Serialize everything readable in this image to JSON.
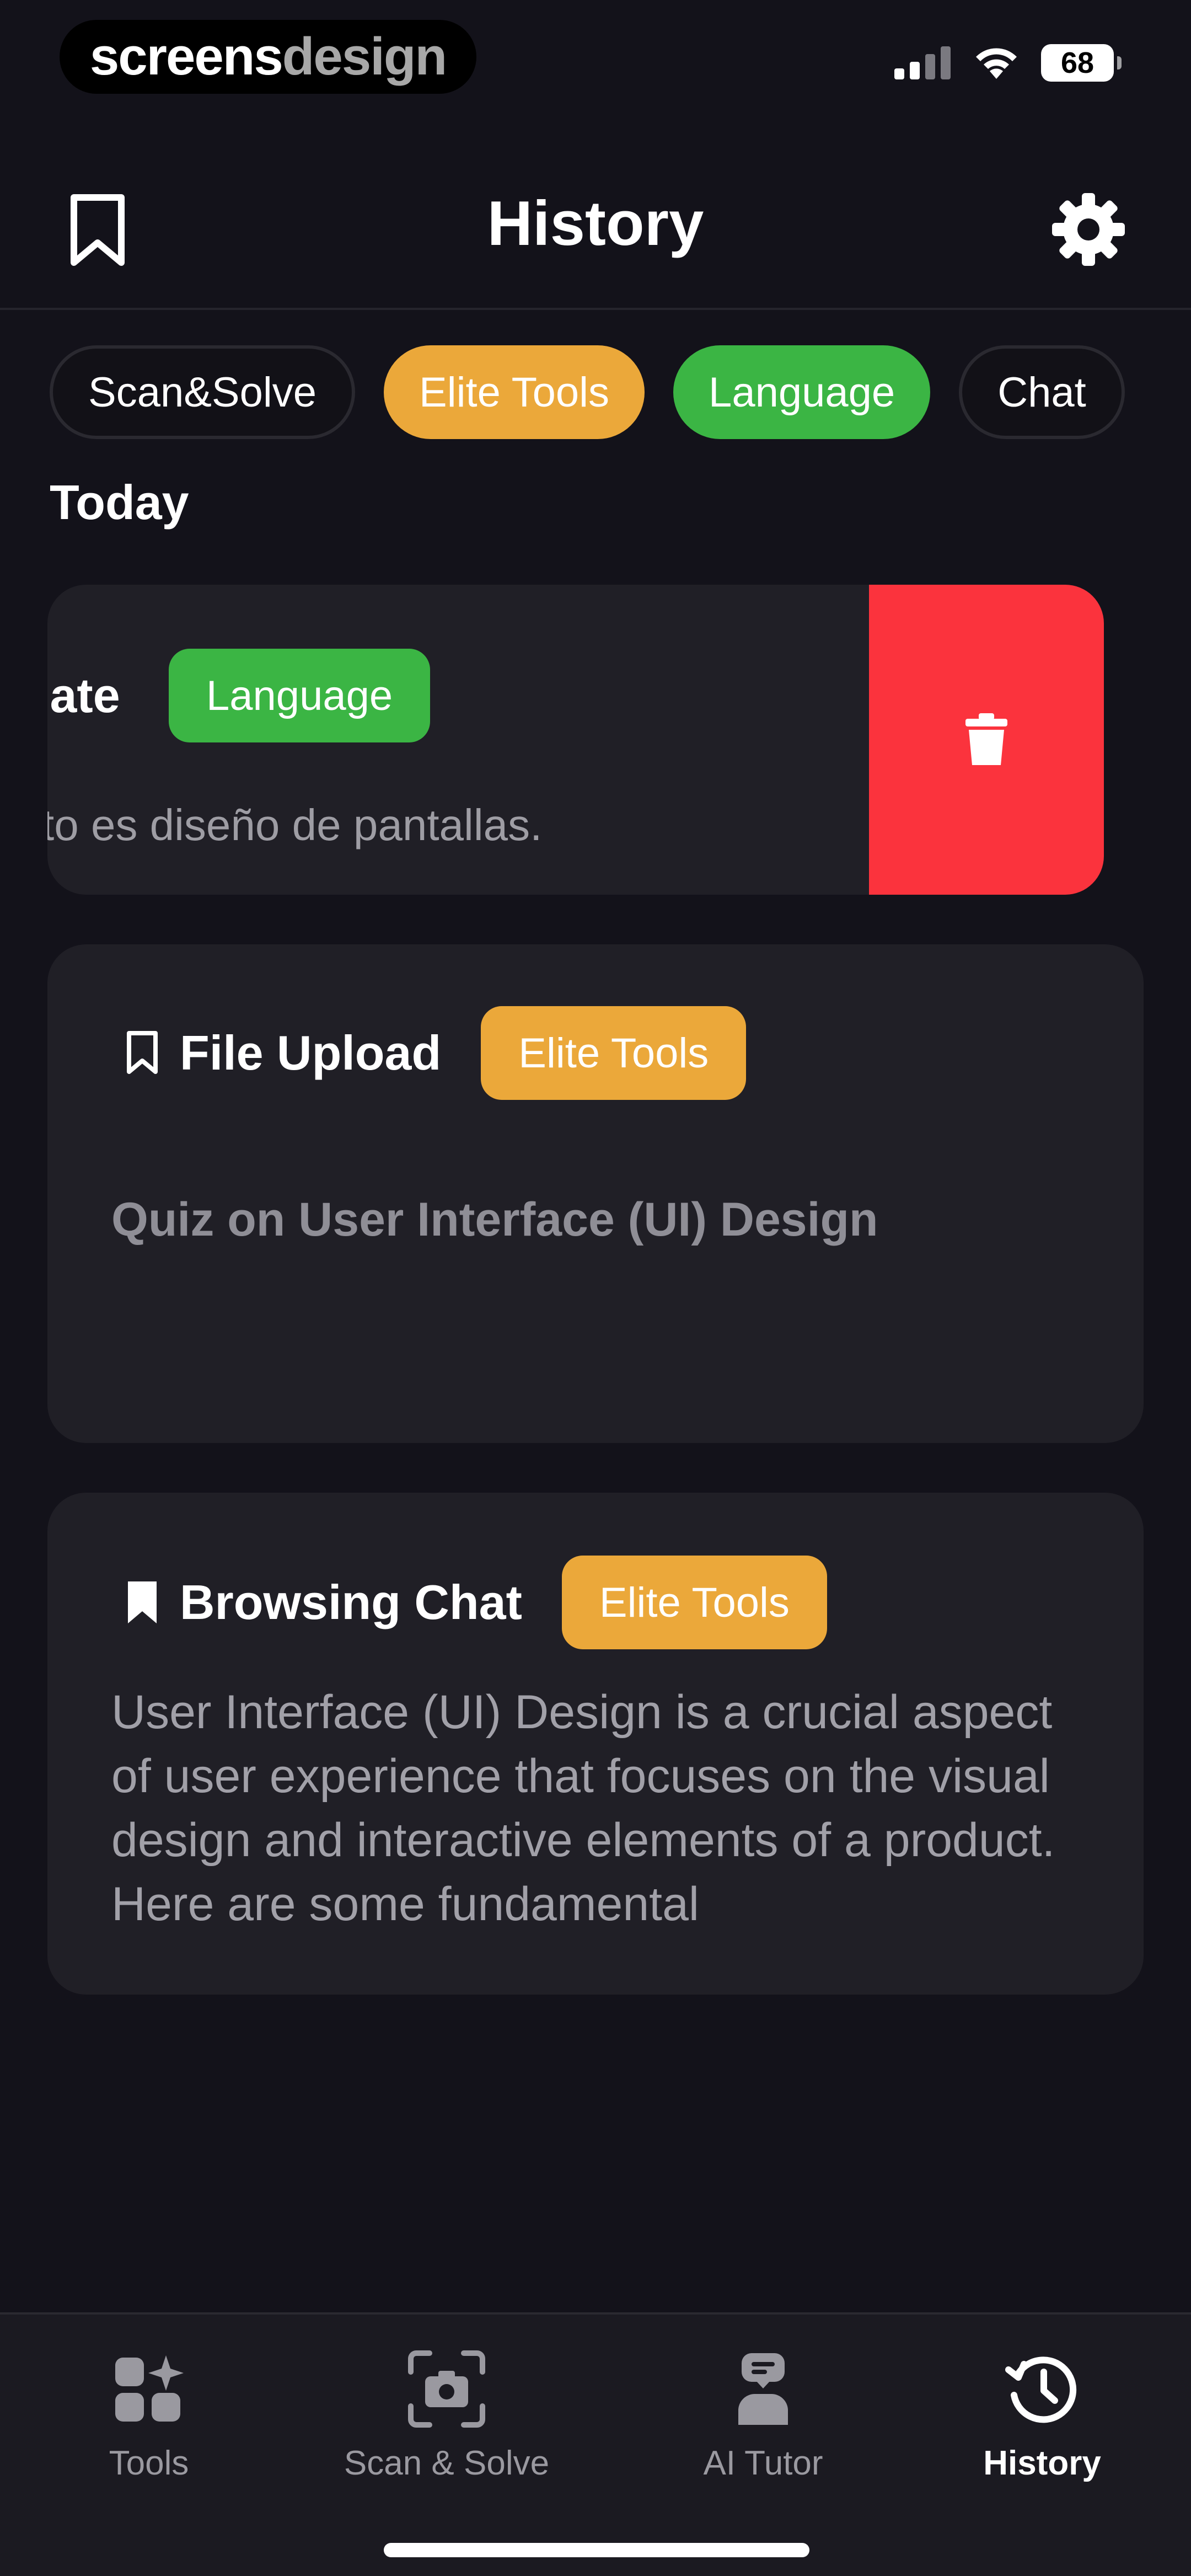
{
  "status_bar": {
    "brand_a": "screens",
    "brand_b": "design",
    "battery": "68"
  },
  "header": {
    "title": "History"
  },
  "filters": [
    {
      "label": "Scan&Solve"
    },
    {
      "label": "Elite Tools"
    },
    {
      "label": "Language"
    },
    {
      "label": "Chat"
    }
  ],
  "section": {
    "label": "Today"
  },
  "cards": [
    {
      "title": "late",
      "tag": "Language",
      "description": "to es diseño de pantallas."
    },
    {
      "title": "File Upload",
      "tag": "Elite Tools",
      "description": "Quiz on User Interface (UI) Design"
    },
    {
      "title": "Browsing Chat",
      "tag": "Elite Tools",
      "description": "User Interface (UI) Design is a crucial aspect of user experience that focuses on the visual design and interactive elements of a product. Here are some fundamental"
    }
  ],
  "nav": [
    {
      "label": "Tools",
      "icon": "tools-icon"
    },
    {
      "label": "Scan & Solve",
      "icon": "camera-icon"
    },
    {
      "label": "AI Tutor",
      "icon": "tutor-icon"
    },
    {
      "label": "History",
      "icon": "history-icon"
    }
  ],
  "colors": {
    "background": "#13121a",
    "card": "#201f26",
    "orange": "#eba83a",
    "green": "#3bb544",
    "delete": "#fb333d"
  }
}
